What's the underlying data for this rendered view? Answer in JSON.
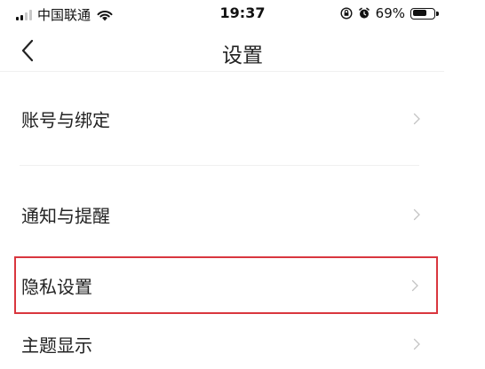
{
  "status_bar": {
    "carrier": "中国联通",
    "time": "19:37",
    "battery_percent": "69%",
    "battery_level": 0.69
  },
  "nav": {
    "title": "设置"
  },
  "settings": {
    "items": [
      {
        "label": "账号与绑定"
      },
      {
        "label": "通知与提醒"
      },
      {
        "label": "隐私设置"
      },
      {
        "label": "主题显示"
      }
    ]
  },
  "highlight": {
    "color": "#d9363e",
    "target": "隐私设置"
  },
  "icons": {
    "back": "chevron-left-icon",
    "row_arrow": "chevron-right-icon",
    "wifi": "wifi-icon",
    "signal": "signal-icon",
    "lock_rotation": "rotation-lock-icon",
    "alarm": "alarm-icon",
    "battery": "battery-icon"
  }
}
